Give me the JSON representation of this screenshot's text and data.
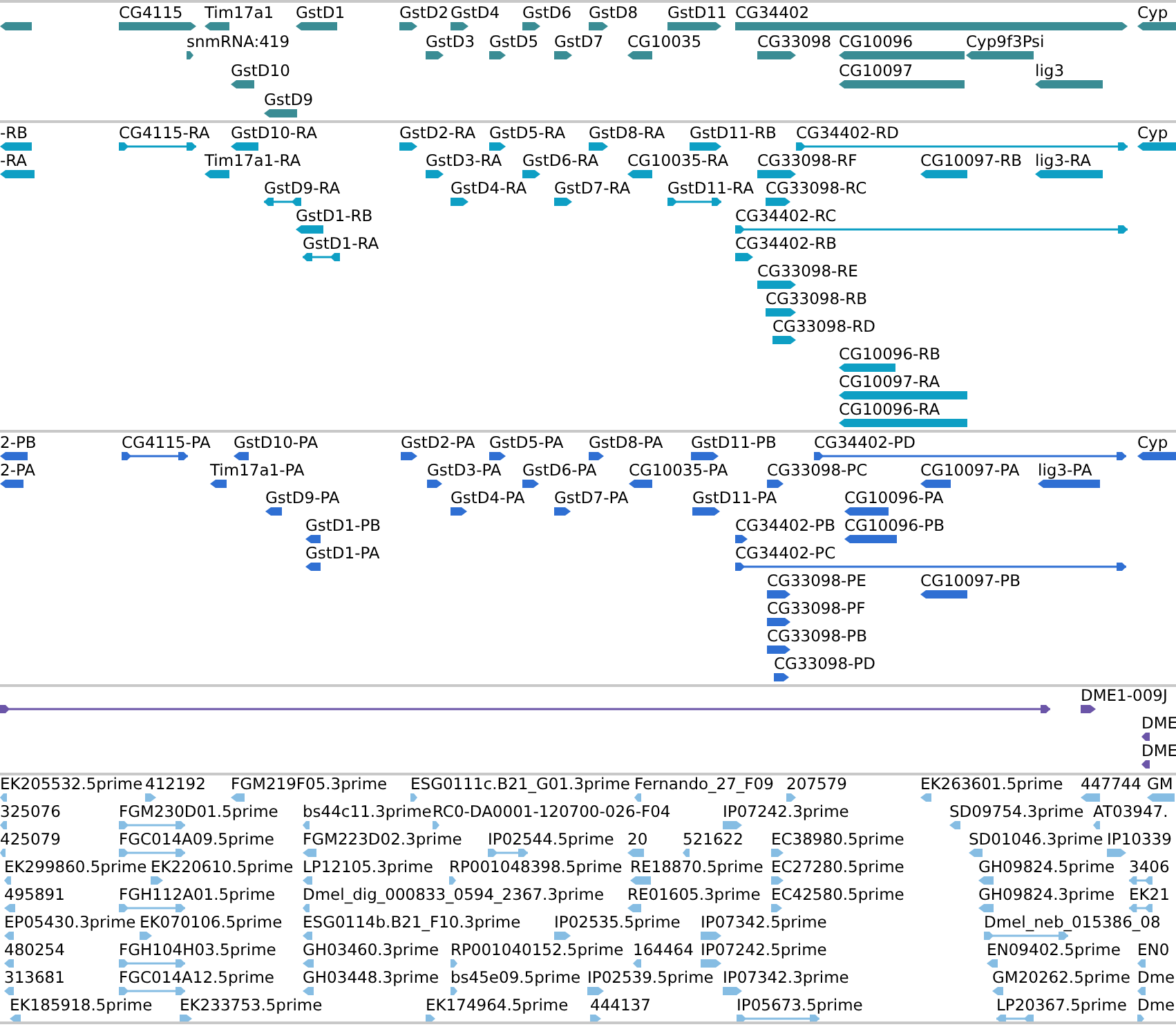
{
  "tracks": [
    {
      "color": "#3a8c94",
      "features": [
        {
          "reverse_strand": true
        },
        {
          "label": "CG4115",
          "reverse_strand": false
        },
        {
          "label": "Tim17a1",
          "reverse_strand": true
        },
        {
          "label": "GstD1",
          "reverse_strand": true
        },
        {
          "label": "GstD2",
          "reverse_strand": false
        },
        {
          "label": "GstD4",
          "reverse_strand": false
        },
        {
          "label": "GstD6",
          "reverse_strand": false
        },
        {
          "label": "GstD8",
          "reverse_strand": false
        },
        {
          "label": "GstD11",
          "reverse_strand": false
        },
        {
          "label": "CG34402",
          "reverse_strand": false
        },
        {
          "label": "Cyp",
          "reverse_strand": true
        },
        {
          "label": "snmRNA:419",
          "reverse_strand": false
        },
        {
          "label": "GstD3",
          "reverse_strand": false
        },
        {
          "label": "GstD5",
          "reverse_strand": false
        },
        {
          "label": "GstD7",
          "reverse_strand": false
        },
        {
          "label": "CG10035",
          "reverse_strand": true
        },
        {
          "label": "CG33098",
          "reverse_strand": false
        },
        {
          "label": "CG10096",
          "reverse_strand": true
        },
        {
          "label": "Cyp9f3Psi",
          "reverse_strand": true
        },
        {
          "label": "GstD10",
          "reverse_strand": true
        },
        {
          "label": "CG10097",
          "reverse_strand": true
        },
        {
          "label": "lig3",
          "reverse_strand": true
        },
        {
          "label": "GstD9",
          "reverse_strand": true
        }
      ]
    },
    {
      "color": "#0e9fc4",
      "features": [
        {
          "label": "-RB",
          "reverse_strand": true
        },
        {
          "label": "CG4115-RA",
          "reverse_strand": false
        },
        {
          "label": "GstD10-RA",
          "reverse_strand": true
        },
        {
          "label": "GstD2-RA",
          "reverse_strand": false
        },
        {
          "label": "GstD5-RA",
          "reverse_strand": false
        },
        {
          "label": "GstD8-RA",
          "reverse_strand": false
        },
        {
          "label": "GstD11-RB",
          "reverse_strand": false
        },
        {
          "label": "CG34402-RD",
          "reverse_strand": false
        },
        {
          "label": "Cyp",
          "reverse_strand": true
        },
        {
          "label": "-RA",
          "reverse_strand": true
        },
        {
          "label": "Tim17a1-RA",
          "reverse_strand": true
        },
        {
          "label": "GstD3-RA",
          "reverse_strand": false
        },
        {
          "label": "GstD6-RA",
          "reverse_strand": false
        },
        {
          "label": "CG10035-RA",
          "reverse_strand": true
        },
        {
          "label": "CG33098-RF",
          "reverse_strand": false
        },
        {
          "label": "CG10097-RB",
          "reverse_strand": true
        },
        {
          "label": "lig3-RA",
          "reverse_strand": true
        },
        {
          "label": "GstD9-RA",
          "reverse_strand": true
        },
        {
          "label": "GstD4-RA",
          "reverse_strand": false
        },
        {
          "label": "GstD7-RA",
          "reverse_strand": false
        },
        {
          "label": "GstD11-RA",
          "reverse_strand": false
        },
        {
          "label": "CG33098-RC",
          "reverse_strand": false
        },
        {
          "label": "GstD1-RB",
          "reverse_strand": true
        },
        {
          "label": "CG34402-RC",
          "reverse_strand": false
        },
        {
          "label": "GstD1-RA",
          "reverse_strand": true
        },
        {
          "label": "CG34402-RB",
          "reverse_strand": false
        },
        {
          "label": "CG33098-RE",
          "reverse_strand": false
        },
        {
          "label": "CG33098-RB",
          "reverse_strand": false
        },
        {
          "label": "CG33098-RD",
          "reverse_strand": false
        },
        {
          "label": "CG10096-RB",
          "reverse_strand": true
        },
        {
          "label": "CG10097-RA",
          "reverse_strand": true
        },
        {
          "label": "CG10096-RA",
          "reverse_strand": true
        }
      ]
    },
    {
      "color": "#2f6fd3",
      "features": [
        {
          "label": "2-PB",
          "reverse_strand": true
        },
        {
          "label": "CG4115-PA",
          "reverse_strand": false
        },
        {
          "label": "GstD10-PA",
          "reverse_strand": true
        },
        {
          "label": "GstD2-PA",
          "reverse_strand": false
        },
        {
          "label": "GstD5-PA",
          "reverse_strand": false
        },
        {
          "label": "GstD8-PA",
          "reverse_strand": false
        },
        {
          "label": "GstD11-PB",
          "reverse_strand": false
        },
        {
          "label": "CG34402-PD",
          "reverse_strand": false
        },
        {
          "label": "Cyp",
          "reverse_strand": true
        },
        {
          "label": "2-PA",
          "reverse_strand": true
        },
        {
          "label": "Tim17a1-PA",
          "reverse_strand": true
        },
        {
          "label": "GstD3-PA",
          "reverse_strand": false
        },
        {
          "label": "GstD6-PA",
          "reverse_strand": false
        },
        {
          "label": "CG10035-PA",
          "reverse_strand": true
        },
        {
          "label": "CG33098-PC",
          "reverse_strand": false
        },
        {
          "label": "CG10097-PA",
          "reverse_strand": true
        },
        {
          "label": "lig3-PA",
          "reverse_strand": true
        },
        {
          "label": "GstD9-PA",
          "reverse_strand": true
        },
        {
          "label": "GstD4-PA",
          "reverse_strand": false
        },
        {
          "label": "GstD7-PA",
          "reverse_strand": false
        },
        {
          "label": "GstD11-PA",
          "reverse_strand": false
        },
        {
          "label": "CG10096-PA",
          "reverse_strand": true
        },
        {
          "label": "GstD1-PB",
          "reverse_strand": true
        },
        {
          "label": "CG34402-PB",
          "reverse_strand": false
        },
        {
          "label": "CG10096-PB",
          "reverse_strand": true
        },
        {
          "label": "GstD1-PA",
          "reverse_strand": true
        },
        {
          "label": "CG34402-PC",
          "reverse_strand": false
        },
        {
          "label": "CG33098-PE",
          "reverse_strand": false
        },
        {
          "label": "CG10097-PB",
          "reverse_strand": true
        },
        {
          "label": "CG33098-PF",
          "reverse_strand": false
        },
        {
          "label": "CG33098-PB",
          "reverse_strand": false
        },
        {
          "label": "CG33098-PD",
          "reverse_strand": false
        }
      ]
    },
    {
      "color": "#6b55a8",
      "features": [
        {
          "reverse_strand": false
        },
        {
          "label": "DME1-009J",
          "reverse_strand": false
        },
        {
          "label": "DME",
          "reverse_strand": true
        },
        {
          "label": "DME",
          "reverse_strand": true
        }
      ]
    },
    {
      "color": "#86bde3",
      "features": [
        {
          "label": "EK205532.5prime",
          "reverse_strand": true
        },
        {
          "label": "412192",
          "reverse_strand": false
        },
        {
          "label": "FGM219F05.3prime",
          "reverse_strand": true
        },
        {
          "label": "ESG0111c.B21_G01.3prime",
          "reverse_strand": false
        },
        {
          "label": "Fernando_27_F09",
          "reverse_strand": true
        },
        {
          "label": "207579",
          "reverse_strand": false
        },
        {
          "label": "EK263601.5prime",
          "reverse_strand": true
        },
        {
          "label": "447744",
          "reverse_strand": true
        },
        {
          "label": "GM",
          "reverse_strand": true
        },
        {
          "label": "325076",
          "reverse_strand": true
        },
        {
          "label": "FGM230D01.5prime",
          "reverse_strand": false
        },
        {
          "label": "bs44c11.3prime",
          "reverse_strand": true
        },
        {
          "label": "RC0-DA0001-120700-026-F04",
          "reverse_strand": false
        },
        {
          "label": "IP07242.3prime",
          "reverse_strand": false
        },
        {
          "label": "SD09754.3prime",
          "reverse_strand": true
        },
        {
          "label": "AT03947.",
          "reverse_strand": true
        },
        {
          "label": "425079",
          "reverse_strand": true
        },
        {
          "label": "FGC014A09.5prime",
          "reverse_strand": false
        },
        {
          "label": "FGM223D02.3prime",
          "reverse_strand": true
        },
        {
          "label": "IP02544.5prime",
          "reverse_strand": false
        },
        {
          "label": "20",
          "reverse_strand": true
        },
        {
          "label": "521622",
          "reverse_strand": true
        },
        {
          "label": "EC38980.5prime",
          "reverse_strand": false
        },
        {
          "label": "SD01046.3prime",
          "reverse_strand": true
        },
        {
          "label": "IP10339",
          "reverse_strand": false
        },
        {
          "label": "EK299860.5prime",
          "reverse_strand": true
        },
        {
          "label": "EK220610.5prime",
          "reverse_strand": false
        },
        {
          "label": "LP12105.3prime",
          "reverse_strand": true
        },
        {
          "label": "RP001048398.5prime",
          "reverse_strand": false
        },
        {
          "label": "RE18870.5prime",
          "reverse_strand": true
        },
        {
          "label": "EC27280.5prime",
          "reverse_strand": false
        },
        {
          "label": "GH09824.5prime",
          "reverse_strand": true
        },
        {
          "label": "3406",
          "reverse_strand": true
        },
        {
          "label": "495891",
          "reverse_strand": true
        },
        {
          "label": "FGH112A01.5prime",
          "reverse_strand": false
        },
        {
          "label": "Dmel_dig_000833_0594_2367.3prime",
          "reverse_strand": true
        },
        {
          "label": "RE01605.3prime",
          "reverse_strand": true
        },
        {
          "label": "EC42580.5prime",
          "reverse_strand": false
        },
        {
          "label": "GH09824.3prime",
          "reverse_strand": true
        },
        {
          "label": "EK21",
          "reverse_strand": true
        },
        {
          "label": "EP05430.3prime",
          "reverse_strand": true
        },
        {
          "label": "EK070106.5prime",
          "reverse_strand": false
        },
        {
          "label": "ESG0114b.B21_F10.3prime",
          "reverse_strand": true
        },
        {
          "label": "IP02535.5prime",
          "reverse_strand": false
        },
        {
          "label": "IP07342.5prime",
          "reverse_strand": false
        },
        {
          "label": "Dmel_neb_015386_08",
          "reverse_strand": false
        },
        {
          "label": "480254",
          "reverse_strand": true
        },
        {
          "label": "FGH104H03.5prime",
          "reverse_strand": false
        },
        {
          "label": "GH03460.3prime",
          "reverse_strand": true
        },
        {
          "label": "RP001040152.5prime",
          "reverse_strand": false
        },
        {
          "label": "164464",
          "reverse_strand": true
        },
        {
          "label": "IP07242.5prime",
          "reverse_strand": false
        },
        {
          "label": "EN09402.5prime",
          "reverse_strand": true
        },
        {
          "label": "EN0",
          "reverse_strand": true
        },
        {
          "label": "313681",
          "reverse_strand": true
        },
        {
          "label": "FGC014A12.5prime",
          "reverse_strand": false
        },
        {
          "label": "GH03448.3prime",
          "reverse_strand": true
        },
        {
          "label": "bs45e09.5prime",
          "reverse_strand": false
        },
        {
          "label": "IP02539.5prime",
          "reverse_strand": false
        },
        {
          "label": "IP07342.3prime",
          "reverse_strand": false
        },
        {
          "label": "GM20262.5prime",
          "reverse_strand": true
        },
        {
          "label": "Dme",
          "reverse_strand": true
        },
        {
          "label": "EK185918.5prime",
          "reverse_strand": true
        },
        {
          "label": "EK233753.5prime",
          "reverse_strand": false
        },
        {
          "label": "EK174964.5prime",
          "reverse_strand": false
        },
        {
          "label": "444137",
          "reverse_strand": false
        },
        {
          "label": "IP05673.5prime",
          "reverse_strand": false
        },
        {
          "label": "LP20367.5prime",
          "reverse_strand": true
        },
        {
          "label": "Dme",
          "reverse_strand": false
        }
      ]
    }
  ]
}
